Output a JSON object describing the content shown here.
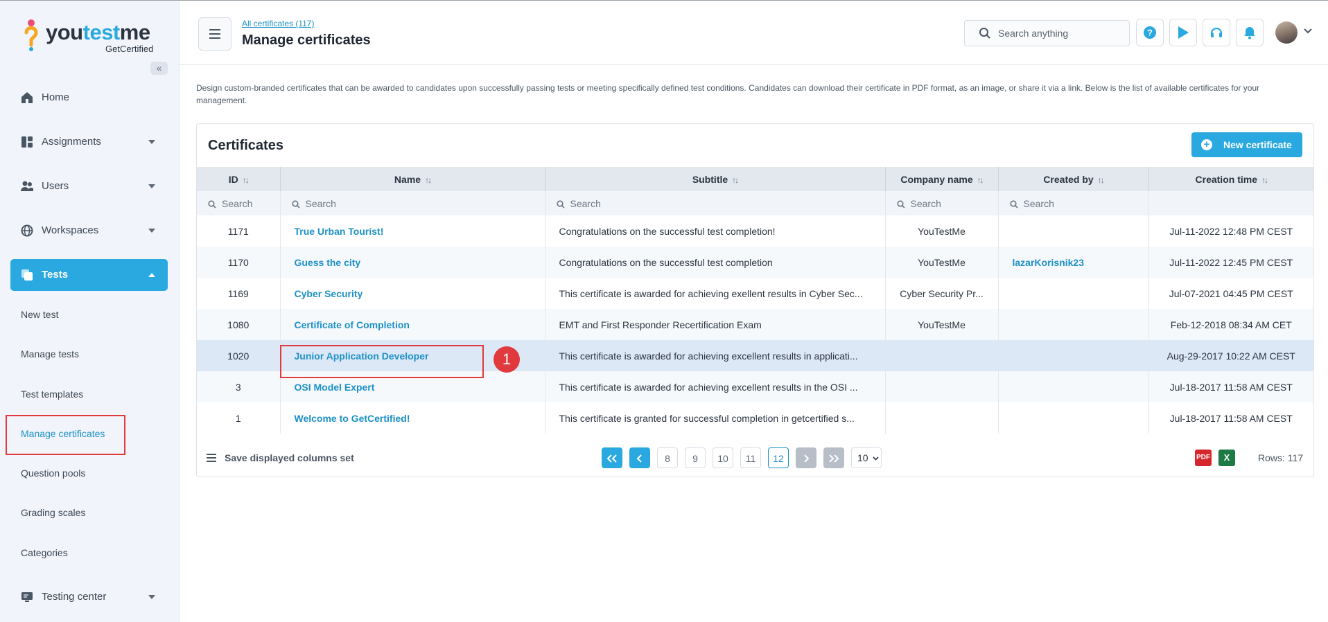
{
  "brand": {
    "name": "youtestme",
    "sub": "GetCertified"
  },
  "sidebar": {
    "collapse_glyph": "«",
    "items": [
      {
        "label": "Home",
        "icon": "home-icon"
      },
      {
        "label": "Assignments",
        "icon": "assignments-icon"
      },
      {
        "label": "Users",
        "icon": "users-icon"
      },
      {
        "label": "Workspaces",
        "icon": "globe-icon"
      },
      {
        "label": "Tests",
        "icon": "tests-icon"
      },
      {
        "label": "Testing center",
        "icon": "monitor-icon"
      }
    ],
    "test_subitems": [
      "New test",
      "Manage tests",
      "Test templates",
      "Manage certificates",
      "Question pools",
      "Grading scales",
      "Categories"
    ]
  },
  "header": {
    "breadcrumb": "All certificates (117)",
    "title": "Manage certificates",
    "search_placeholder": "Search anything"
  },
  "description": "Design custom-branded certificates that can be awarded to candidates upon successfully passing tests or meeting specifically defined test conditions. Candidates can download their certificate in PDF format, as an image, or share it via a link. Below is the list of available certificates for your management.",
  "panel": {
    "title": "Certificates",
    "new_button": "New certificate",
    "columns": [
      "ID",
      "Name",
      "Subtitle",
      "Company name",
      "Created by",
      "Creation time"
    ],
    "filter_placeholder": "Search",
    "rows": [
      {
        "id": "1171",
        "name": "True Urban Tourist!",
        "subtitle": "Congratulations on the successful test completion!",
        "company": "YouTestMe",
        "created_by": "",
        "time": "Jul-11-2022 12:48 PM CEST"
      },
      {
        "id": "1170",
        "name": "Guess the city",
        "subtitle": "Congratulations on the successful test completion",
        "company": "YouTestMe",
        "created_by": "lazarKorisnik23",
        "time": "Jul-11-2022 12:45 PM CEST"
      },
      {
        "id": "1169",
        "name": "Cyber Security",
        "subtitle": "This certificate is awarded for achieving exellent results in Cyber Sec...",
        "company": "Cyber Security Pr...",
        "created_by": "",
        "time": "Jul-07-2021 04:45 PM CEST"
      },
      {
        "id": "1080",
        "name": "Certificate of Completion",
        "subtitle": "EMT and First Responder Recertification Exam",
        "company": "YouTestMe",
        "created_by": "",
        "time": "Feb-12-2018 08:34 AM CET"
      },
      {
        "id": "1020",
        "name": "Junior Application Developer",
        "subtitle": "This certificate is awarded for achieving excellent results in applicati...",
        "company": "",
        "created_by": "",
        "time": "Aug-29-2017 10:22 AM CEST"
      },
      {
        "id": "3",
        "name": "OSI Model Expert",
        "subtitle": "This certificate is awarded for achieving excellent results in the OSI ...",
        "company": "",
        "created_by": "",
        "time": "Jul-18-2017 11:58 AM CEST"
      },
      {
        "id": "1",
        "name": "Welcome to GetCertified!",
        "subtitle": "This certificate is granted for successful completion in getcertified s...",
        "company": "",
        "created_by": "",
        "time": "Jul-18-2017 11:58 AM CEST"
      }
    ],
    "footer": {
      "save_columns": "Save displayed columns set",
      "pages": [
        "8",
        "9",
        "10",
        "11",
        "12"
      ],
      "current_page": "12",
      "page_size": "10",
      "rows_label": "Rows: 117",
      "pdf_label": "PDF",
      "excel_label": "X"
    }
  },
  "annotation": {
    "step": "1"
  },
  "colors": {
    "accent": "#29a9e0",
    "link": "#1c90c6",
    "highlight": "#e0393e",
    "sidebar_bg": "#f1f5fb"
  }
}
